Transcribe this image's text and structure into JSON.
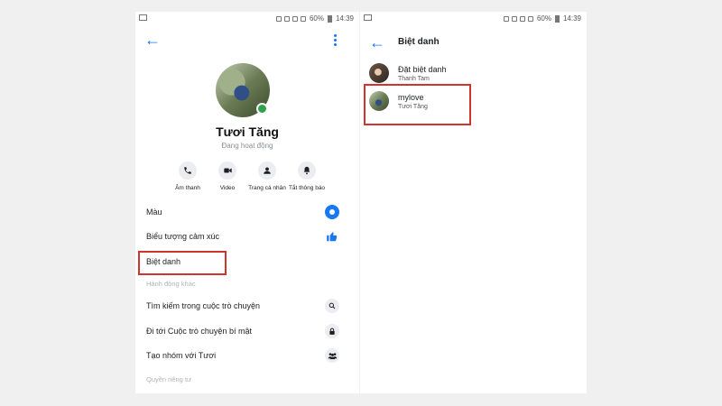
{
  "status_bar": {
    "left_icon": "gallery-notification-icon",
    "battery_percent": "60%",
    "time": "14:39",
    "right_icons": [
      "mute-icon",
      "wifi-icon",
      "alarm-icon",
      "signal-icon",
      "signal-icon",
      "battery-icon"
    ]
  },
  "left_screen": {
    "back_icon": "back-arrow-icon",
    "more_icon": "more-vertical-icon",
    "profile": {
      "name": "Tươi Tăng",
      "status": "Đang hoạt động",
      "online": true
    },
    "actions": [
      {
        "label": "Âm thanh",
        "icon": "phone-icon"
      },
      {
        "label": "Video",
        "icon": "video-camera-icon"
      },
      {
        "label": "Trang cá nhân",
        "icon": "person-icon"
      },
      {
        "label": "Tắt thông báo",
        "icon": "bell-icon"
      }
    ],
    "menu": {
      "color_label": "Màu",
      "emoji_label": "Biểu tượng cảm xúc",
      "nickname_label": "Biệt danh",
      "other_actions_header": "Hành động khác",
      "search_label": "Tìm kiếm trong cuộc trò chuyện",
      "secret_label": "Đi tới Cuộc trò chuyện bí mật",
      "group_label": "Tạo nhóm với Tươi",
      "privacy_header": "Quyền riêng tư"
    }
  },
  "right_screen": {
    "back_icon": "back-arrow-icon",
    "title": "Biệt danh",
    "nicknames": [
      {
        "main": "Đặt biệt danh",
        "sub": "Thanh Tam"
      },
      {
        "main": "mylove",
        "sub": "Tươi Tăng"
      }
    ]
  },
  "colors": {
    "messenger_blue": "#1877f2",
    "highlight_red": "#d0342c",
    "online_green": "#31a24c",
    "background": "#f0f0f0"
  }
}
